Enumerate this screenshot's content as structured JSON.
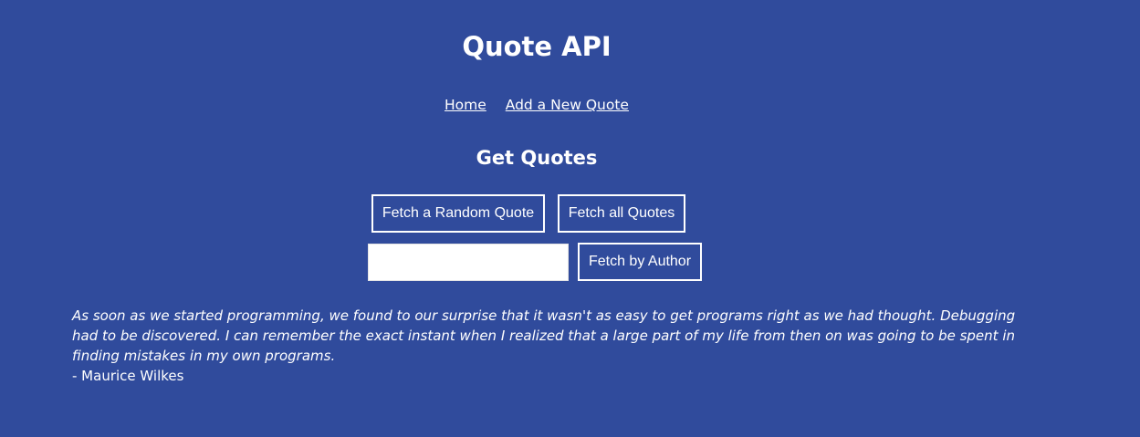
{
  "header": {
    "title": "Quote API"
  },
  "nav": {
    "home": "Home",
    "add_quote": "Add a New Quote"
  },
  "main": {
    "heading": "Get Quotes",
    "random_button": "Fetch a Random Quote",
    "all_button": "Fetch all Quotes",
    "author_input": {
      "value": "",
      "placeholder": ""
    },
    "author_button": "Fetch by Author"
  },
  "quote": {
    "text": "As soon as we started programming, we found to our surprise that it wasn't as easy to get programs right as we had thought. Debugging had to be discovered. I can remember the exact instant when I realized that a large part of my life from then on was going to be spent in finding mistakes in my own programs.",
    "author": "- Maurice Wilkes"
  },
  "colors": {
    "background": "#304b9c",
    "text": "#ffffff"
  }
}
